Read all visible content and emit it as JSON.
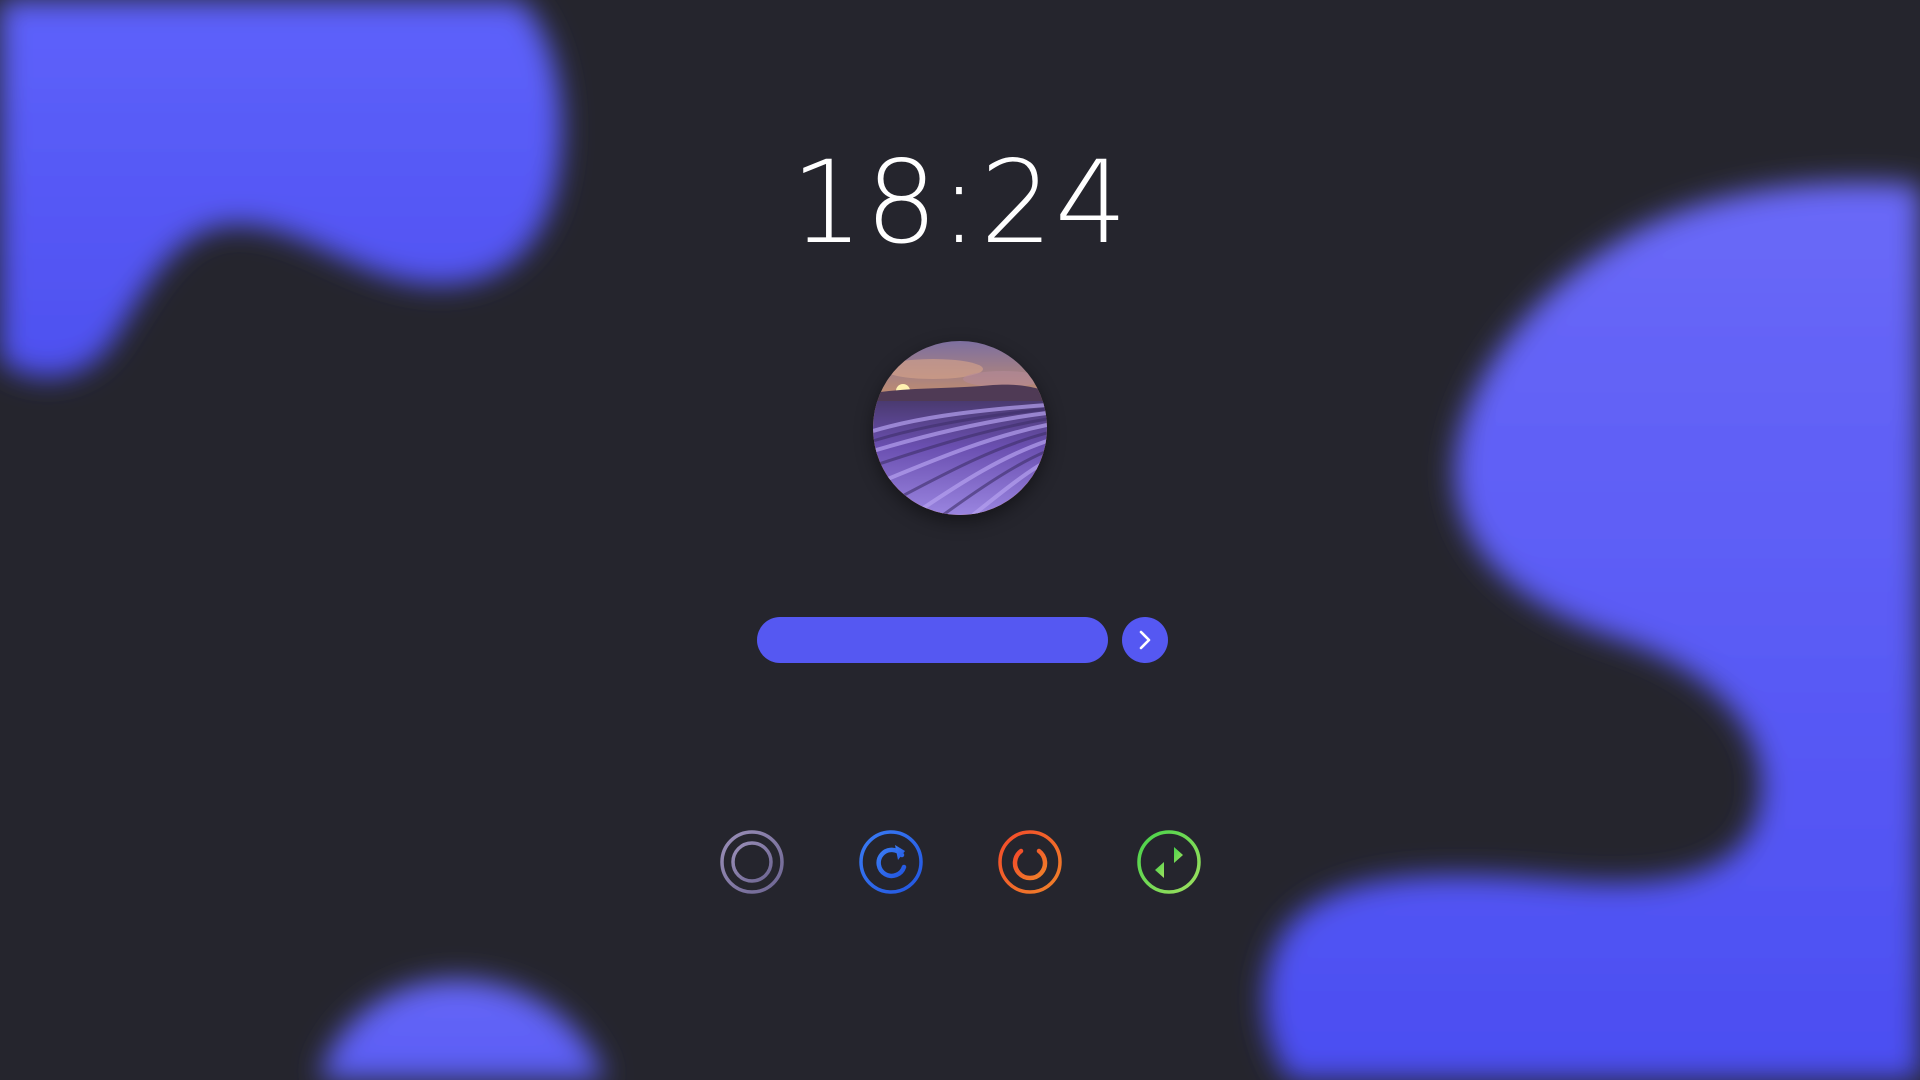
{
  "clock": {
    "time": "18:24"
  },
  "user": {
    "avatar_icon": "lavender-field-sunset-avatar"
  },
  "login": {
    "password_value": "",
    "password_placeholder": "",
    "submit_icon": "chevron-right-icon"
  },
  "power_actions": [
    {
      "name": "suspend-button",
      "icon": "suspend-icon",
      "color": "#8a7fa8"
    },
    {
      "name": "restart-button",
      "icon": "restart-icon",
      "color": "#2f6cf0"
    },
    {
      "name": "shutdown-button",
      "icon": "power-icon",
      "color": "#f0522a"
    },
    {
      "name": "switch-user-button",
      "icon": "switch-user-icon",
      "color": "#6fe04a"
    }
  ],
  "colors": {
    "background": "#25252d",
    "accent": "#5558f2",
    "blob": "#5a5dfa"
  }
}
